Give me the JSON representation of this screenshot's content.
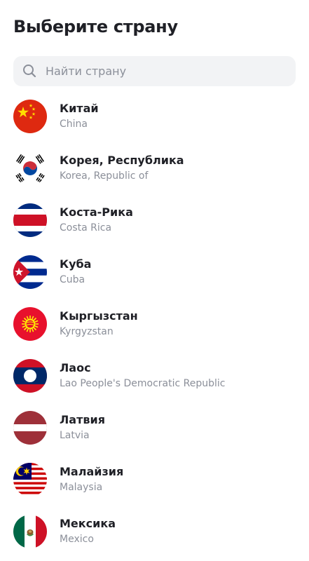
{
  "header": {
    "title": "Выберите страну"
  },
  "search": {
    "placeholder": "Найти страну",
    "value": "",
    "icon": "search-icon"
  },
  "countries": [
    {
      "name": "Китай",
      "english": "China",
      "flag": "china-flag-icon"
    },
    {
      "name": "Корея, Республика",
      "english": "Korea, Republic of",
      "flag": "south-korea-flag-icon"
    },
    {
      "name": "Коста-Рика",
      "english": "Costa Rica",
      "flag": "costa-rica-flag-icon"
    },
    {
      "name": "Куба",
      "english": "Cuba",
      "flag": "cuba-flag-icon"
    },
    {
      "name": "Кыргызстан",
      "english": "Kyrgyzstan",
      "flag": "kyrgyzstan-flag-icon"
    },
    {
      "name": "Лаос",
      "english": "Lao People's Democratic Republic",
      "flag": "laos-flag-icon"
    },
    {
      "name": "Латвия",
      "english": "Latvia",
      "flag": "latvia-flag-icon"
    },
    {
      "name": "Малайзия",
      "english": "Malaysia",
      "flag": "malaysia-flag-icon"
    },
    {
      "name": "Мексика",
      "english": "Mexico",
      "flag": "mexico-flag-icon"
    }
  ]
}
